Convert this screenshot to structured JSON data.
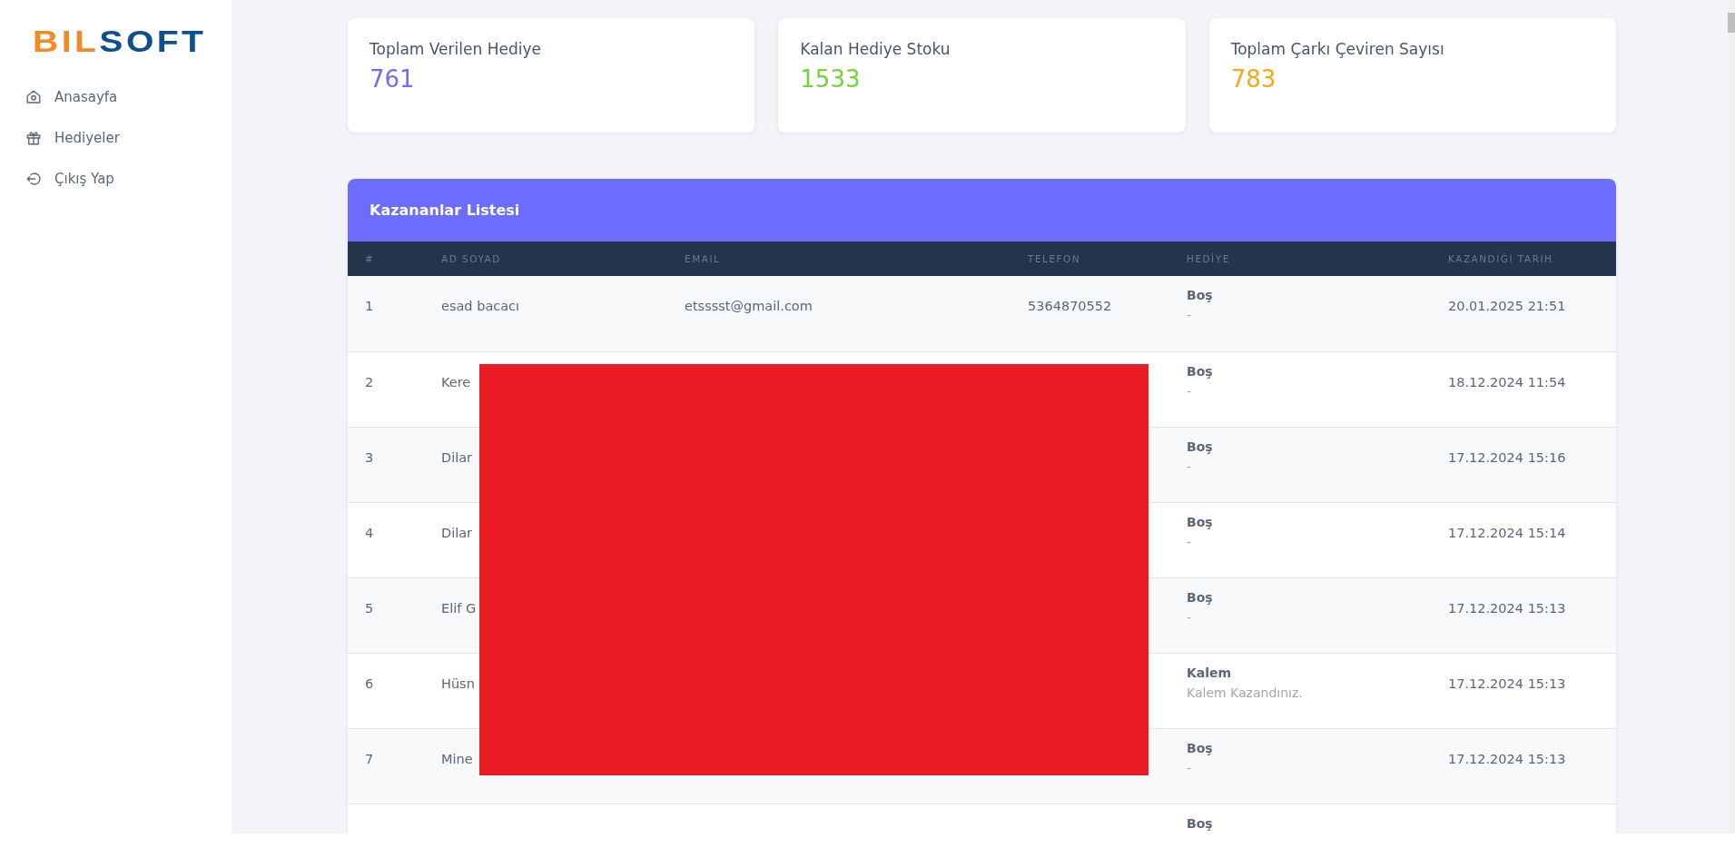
{
  "sidebar": {
    "logo": {
      "part_1": "BIL",
      "part_2": "SOFT"
    },
    "items": [
      {
        "label": "Anasayfa"
      },
      {
        "label": "Hediyeler"
      },
      {
        "label": "Çıkış Yap"
      }
    ]
  },
  "stats": [
    {
      "title": "Toplam Verilen Hediye",
      "value": "761",
      "color": "#6c6cf5"
    },
    {
      "title": "Kalan Hediye Stoku",
      "value": "1533",
      "color": "#72d33a"
    },
    {
      "title": "Toplam Çarkı Çeviren Sayısı",
      "value": "783",
      "color": "#f5a916"
    }
  ],
  "table": {
    "title": "Kazananlar Listesi",
    "columns": [
      "#",
      "AD SOYAD",
      "EMAIL",
      "TELEFON",
      "HEDİYE",
      "KAZANDIĞI TARIH"
    ],
    "rows": [
      {
        "no": "1",
        "name": "esad bacacı",
        "email": "etsssst@gmail.com",
        "phone": "5364870552",
        "gift": "Boş",
        "gift_note": "-",
        "date": "20.01.2025 21:51"
      },
      {
        "no": "2",
        "name": "Kere",
        "gift": "Boş",
        "gift_note": "-",
        "date": "18.12.2024 11:54"
      },
      {
        "no": "3",
        "name": "Dilar",
        "gift": "Boş",
        "gift_note": "-",
        "date": "17.12.2024 15:16"
      },
      {
        "no": "4",
        "name": "Dilar",
        "gift": "Boş",
        "gift_note": "-",
        "date": "17.12.2024 15:14"
      },
      {
        "no": "5",
        "name": "Elif G",
        "gift": "Boş",
        "gift_note": "-",
        "date": "17.12.2024 15:13"
      },
      {
        "no": "6",
        "name": "Hüsn",
        "gift": "Kalem",
        "gift_note": "Kalem Kazandınız.",
        "date": "17.12.2024 15:13"
      },
      {
        "no": "7",
        "name": "Mine",
        "gift": "Boş",
        "gift_note": "-",
        "date": "17.12.2024 15:13"
      },
      {
        "gift": "Boş"
      }
    ]
  }
}
